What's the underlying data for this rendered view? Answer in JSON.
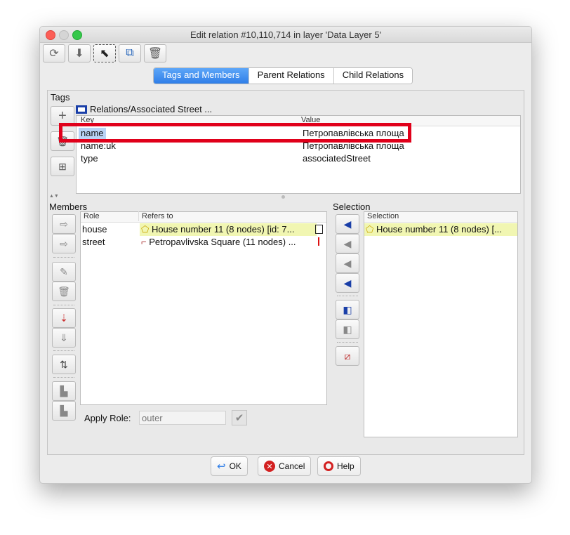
{
  "window": {
    "title": "Edit relation #10,110,714 in layer 'Data Layer 5'"
  },
  "toolbar": {
    "buttons": [
      {
        "icon": "refresh-icon"
      },
      {
        "icon": "apply-icon"
      },
      {
        "icon": "select-icon"
      },
      {
        "icon": "duplicate-icon"
      },
      {
        "icon": "delete-icon"
      }
    ]
  },
  "tabs": [
    "Tags and Members",
    "Parent Relations",
    "Child Relations"
  ],
  "tags": {
    "label": "Tags",
    "preset": "Relations/Associated Street ...",
    "columns": {
      "key": "Key",
      "value": "Value"
    },
    "rows": [
      {
        "key": "name",
        "value": "Петропавлівська площа"
      },
      {
        "key": "name:uk",
        "value": "Петропавлівська площа"
      },
      {
        "key": "type",
        "value": "associatedStreet"
      }
    ]
  },
  "members": {
    "label": "Members",
    "columns": {
      "role": "Role",
      "refers_to": "Refers to"
    },
    "rows": [
      {
        "role": "house",
        "refers_to": "House number 11 (8 nodes) [id: 7..."
      },
      {
        "role": "street",
        "refers_to": "Petropavlivska Square (11 nodes) ..."
      }
    ],
    "apply_role_label": "Apply Role:",
    "apply_role_placeholder": "outer"
  },
  "selection": {
    "label": "Selection",
    "column": "Selection",
    "rows": [
      "House number 11 (8 nodes) [..."
    ]
  },
  "buttons": {
    "ok": "OK",
    "cancel": "Cancel",
    "help": "Help"
  },
  "colors": {
    "accent": "#2f7ee8",
    "highlight_box": "#e0001a",
    "row_highlight": "#f1f6b2",
    "selected_cell": "#b9d3f5"
  }
}
